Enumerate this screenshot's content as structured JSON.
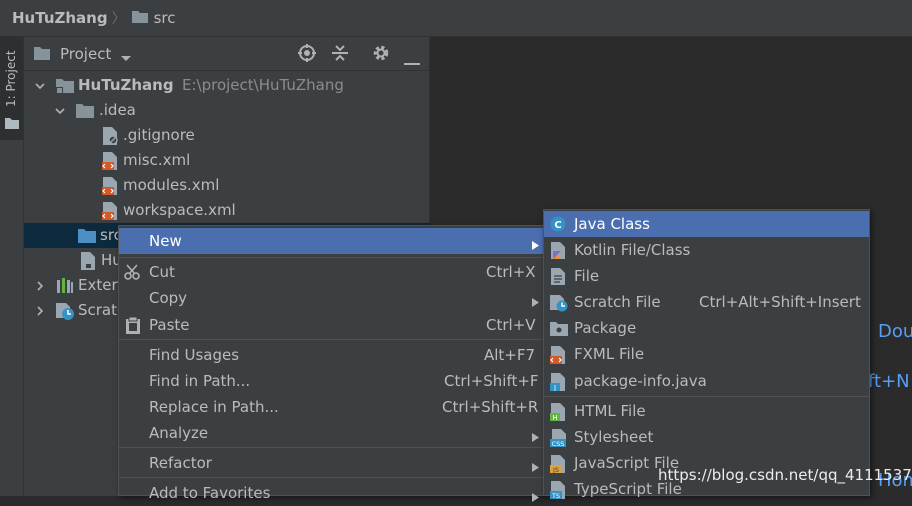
{
  "nav": {
    "project": "HuTuZhang",
    "separator": "〉",
    "folder": "src"
  },
  "stripe": {
    "label": "1: Project"
  },
  "panel": {
    "title": "Project"
  },
  "tree": [
    {
      "label": "HuTuZhang",
      "path": "E:\\project\\HuTuZhang"
    },
    {
      "label": ".idea"
    },
    {
      "label": ".gitignore"
    },
    {
      "label": "misc.xml"
    },
    {
      "label": "modules.xml"
    },
    {
      "label": "workspace.xml"
    },
    {
      "label": "src"
    },
    {
      "label": "Hu"
    },
    {
      "label": "Extern"
    },
    {
      "label": "Scrato"
    }
  ],
  "editor_hints": {
    "double_shift": "Dou",
    "shortcut": "ft+N",
    "partial": "Hom"
  },
  "context_menu": {
    "items": [
      {
        "label": "New",
        "shortcut": ""
      },
      {
        "label": "Cut",
        "shortcut": "Ctrl+X"
      },
      {
        "label": "Copy",
        "shortcut": ""
      },
      {
        "label": "Paste",
        "shortcut": "Ctrl+V"
      },
      {
        "label": "Find Usages",
        "shortcut": "Alt+F7"
      },
      {
        "label": "Find in Path...",
        "shortcut": "Ctrl+Shift+F"
      },
      {
        "label": "Replace in Path...",
        "shortcut": "Ctrl+Shift+R"
      },
      {
        "label": "Analyze",
        "shortcut": ""
      },
      {
        "label": "Refactor",
        "shortcut": ""
      },
      {
        "label": "Add to Favorites",
        "shortcut": ""
      }
    ]
  },
  "new_submenu": {
    "items": [
      {
        "label": "Java Class",
        "shortcut": ""
      },
      {
        "label": "Kotlin File/Class",
        "shortcut": ""
      },
      {
        "label": "File",
        "shortcut": ""
      },
      {
        "label": "Scratch File",
        "shortcut": "Ctrl+Alt+Shift+Insert"
      },
      {
        "label": "Package",
        "shortcut": ""
      },
      {
        "label": "FXML File",
        "shortcut": ""
      },
      {
        "label": "package-info.java",
        "shortcut": ""
      },
      {
        "label": "HTML File",
        "shortcut": ""
      },
      {
        "label": "Stylesheet",
        "shortcut": ""
      },
      {
        "label": "JavaScript File",
        "shortcut": ""
      },
      {
        "label": "TypeScript File",
        "shortcut": ""
      }
    ]
  },
  "watermark": "https://blog.csdn.net/qq_41115379",
  "colors": {
    "highlight": "#4b6eaf",
    "selection": "#0d293e",
    "hint": "#589df6"
  }
}
